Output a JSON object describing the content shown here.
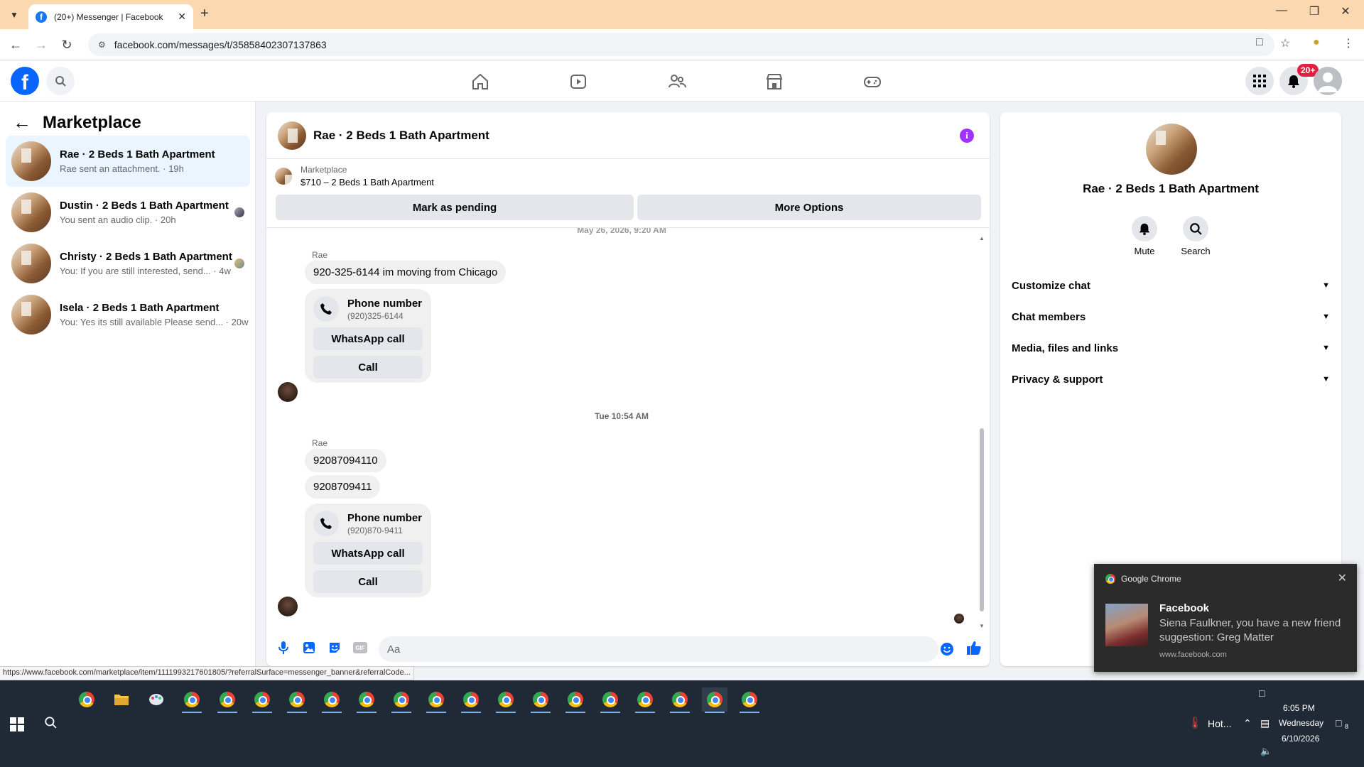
{
  "browser": {
    "tab_title": "(20+) Messenger | Facebook",
    "url": "facebook.com/messages/t/35858402307137863",
    "status_url": "https://www.facebook.com/marketplace/item/1111993217601805/?referralSurface=messenger_banner&referralCode..."
  },
  "fbnav": {
    "notif_badge": "20+"
  },
  "left": {
    "title": "Marketplace",
    "conversations": [
      {
        "name": "Rae · 2 Beds 1 Bath Apartment",
        "snippet": "Rae sent an attachment. · 19h"
      },
      {
        "name": "Dustin · 2 Beds 1 Bath Apartment",
        "snippet": "You sent an audio clip. · 20h"
      },
      {
        "name": "Christy · 2 Beds 1 Bath Apartment",
        "snippet": "You: If you are still interested, send... · 4w"
      },
      {
        "name": "Isela · 2 Beds 1 Bath Apartment",
        "snippet": "You: Yes its still available Please send... · 20w"
      }
    ]
  },
  "chat": {
    "title": "Rae · 2 Beds 1 Bath Apartment",
    "listing_label": "Marketplace",
    "listing_title": "$710 – 2 Beds 1 Bath Apartment",
    "btn_pending": "Mark as pending",
    "btn_more": "More Options",
    "timestamp_1": "May 26, 2026, 9:20 AM",
    "timestamp_2": "Tue 10:54 AM",
    "sender_name": "Rae",
    "msg_1": "920-325-6144 im moving from Chicago",
    "card_1": {
      "title": "Phone number",
      "number": "(920)325-6144",
      "whatsapp": "WhatsApp call",
      "call": "Call"
    },
    "msg_2": "92087094110",
    "msg_3": "9208709411",
    "card_2": {
      "title": "Phone number",
      "number": "(920)870-9411",
      "whatsapp": "WhatsApp call",
      "call": "Call"
    },
    "composer_placeholder": "Aa"
  },
  "right": {
    "name": "Rae · 2 Beds 1 Bath Apartment",
    "mute_label": "Mute",
    "search_label": "Search",
    "sections": [
      "Customize chat",
      "Chat members",
      "Media, files and links",
      "Privacy & support"
    ]
  },
  "toast": {
    "app": "Google Chrome",
    "title": "Facebook",
    "body": "Siena Faulkner, you have a new friend suggestion: Greg Matter",
    "url": "www.facebook.com"
  },
  "taskbar": {
    "weather": "Hot...",
    "time": "6:05 PM",
    "day": "Wednesday",
    "date": "6/10/2026",
    "notif_count": "8"
  }
}
